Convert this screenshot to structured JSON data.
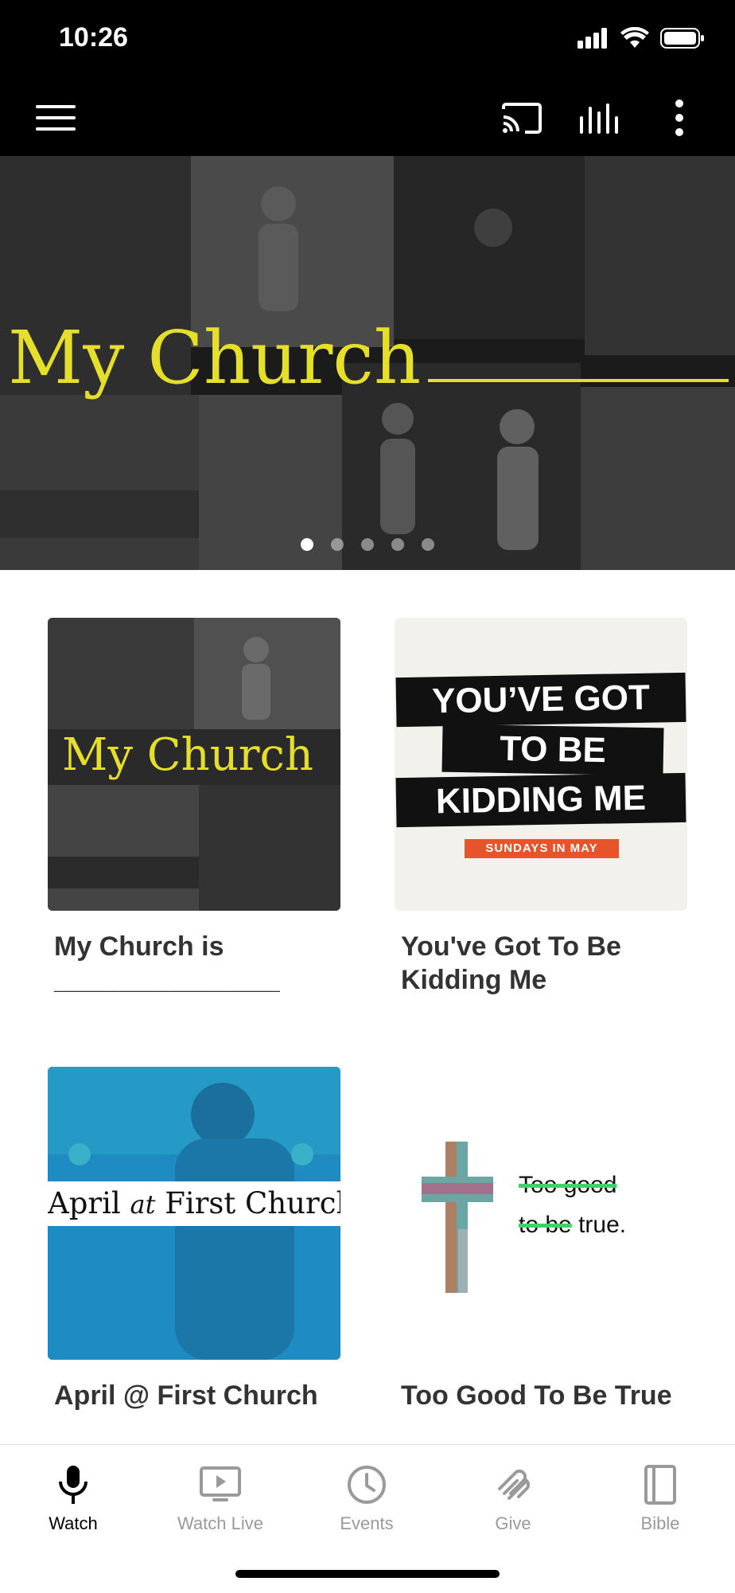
{
  "status": {
    "time": "10:26"
  },
  "hero": {
    "title": "My Church",
    "slides": 5,
    "active_slide": 1
  },
  "cards": [
    {
      "title": "My Church is _______________",
      "thumb_text": "My Church"
    },
    {
      "title": "You've Got To Be Kidding Me",
      "thumb_lines": [
        "YOU’VE GOT",
        "TO BE",
        "KIDDING ME"
      ],
      "thumb_tag": "SUNDAYS IN MAY"
    },
    {
      "title": "April @ First Church",
      "thumb_text_a": "April",
      "thumb_text_at": "at",
      "thumb_text_b": "First Church"
    },
    {
      "title": "Too Good To Be True",
      "thumb_line1": "Too good",
      "thumb_line2_strike": "to be",
      "thumb_line2_rest": " true."
    }
  ],
  "tabs": [
    {
      "label": "Watch",
      "icon": "microphone-icon",
      "active": true
    },
    {
      "label": "Watch Live",
      "icon": "tv-play-icon",
      "active": false
    },
    {
      "label": "Events",
      "icon": "clock-icon",
      "active": false
    },
    {
      "label": "Give",
      "icon": "give-icon",
      "active": false
    },
    {
      "label": "Bible",
      "icon": "book-icon",
      "active": false
    }
  ],
  "colors": {
    "accent_yellow": "#e6df2a",
    "tag_orange": "#e8542a",
    "blue_overlay": "#1f8fc6",
    "strike_green": "#3fd16b"
  }
}
